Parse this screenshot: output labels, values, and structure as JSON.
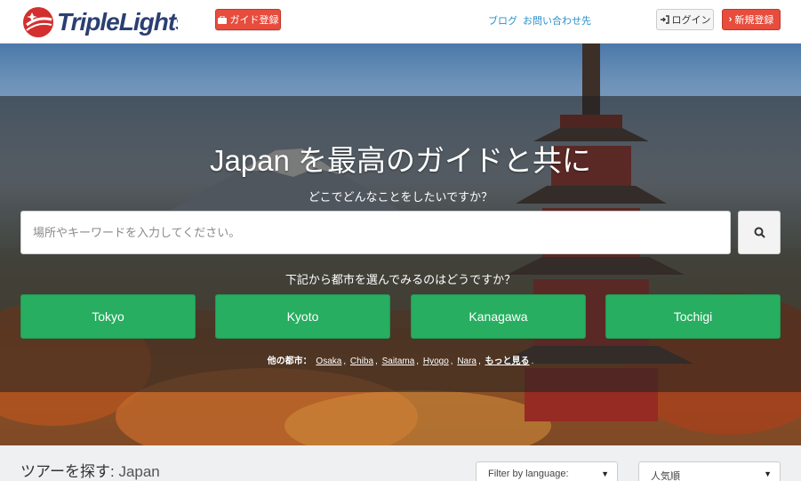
{
  "header": {
    "logo_text": "TripleLights",
    "guide_button": "ガイド登録",
    "blog_link": "ブログ",
    "contact_link": "お問い合わせ先",
    "login_button": "ログイン",
    "signup_button": "新規登録"
  },
  "hero": {
    "title": "Japan を最高のガイドと共に",
    "subtitle": "どこでどんなことをしたいですか？",
    "search_placeholder": "場所やキーワードを入力してください。",
    "cities_question": "下記から都市を選んでみるのはどうですか？",
    "cities": [
      "Tokyo",
      "Kyoto",
      "Kanagawa",
      "Tochigi"
    ],
    "other_cities_label": "他の都市：",
    "other_cities": [
      "Osaka",
      "Chiba",
      "Saitama",
      "Hyogo",
      "Nara"
    ],
    "more_link": "もっと見る"
  },
  "tours": {
    "title_prefix": "ツアーを探す:",
    "location": "Japan",
    "language_filter": "Filter by language:",
    "sort_select": "人気順"
  },
  "colors": {
    "accent_red": "#e74c3c",
    "city_green": "#27ae60",
    "link_blue": "#2a8fc9",
    "logo_navy": "#2b3f72"
  }
}
